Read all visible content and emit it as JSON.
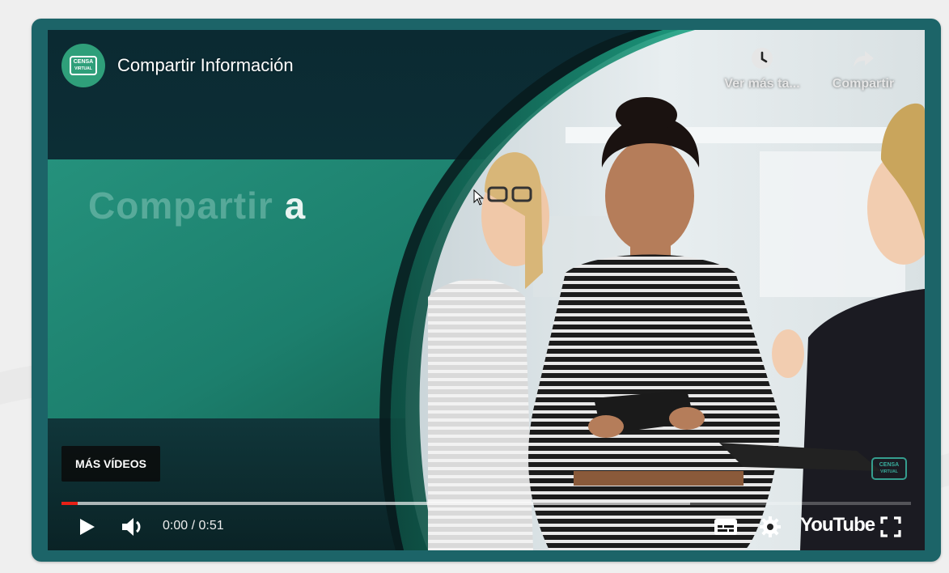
{
  "player": {
    "channel_logo_text": [
      "CENSA",
      "VIRTUAL"
    ],
    "title": "Compartir Información",
    "watch_later_label": "Ver más ta...",
    "share_label": "Compartir",
    "headline_part1": "Compartir",
    "headline_part2": "a",
    "more_videos_label": "MÁS VÍDEOS",
    "brand_mark_text": [
      "CENSA",
      "VIRTUAL"
    ],
    "time": "0:00 / 0:51",
    "progress_fraction": 0.0,
    "buffered_fraction": 0.74,
    "youtube_label": "YouTube"
  },
  "icons": {
    "watch_later": "clock-icon",
    "share": "share-arrow-icon",
    "play": "play-icon",
    "volume": "volume-icon",
    "subtitles": "subtitles-icon",
    "settings": "gear-icon",
    "fullscreen": "fullscreen-icon"
  },
  "colors": {
    "frame": "#1c6468",
    "teal_panel": "#1f8f7a",
    "progress": "#e62117",
    "logo": "#2f9f7a"
  }
}
